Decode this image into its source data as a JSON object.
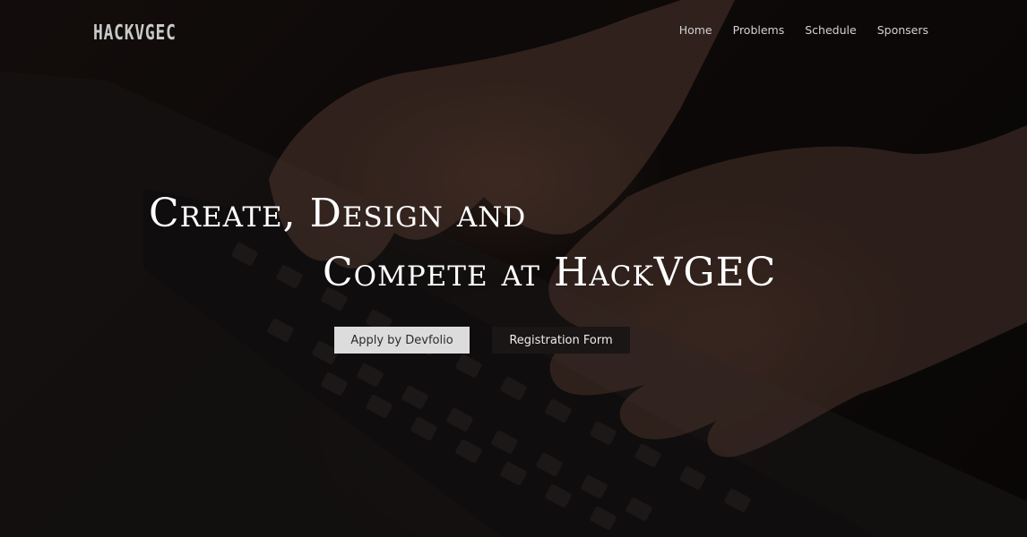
{
  "brand": {
    "logo_text": "HACKVGEC"
  },
  "nav": {
    "items": [
      {
        "label": "Home"
      },
      {
        "label": "Problems"
      },
      {
        "label": "Schedule"
      },
      {
        "label": "Sponsers"
      }
    ]
  },
  "hero": {
    "headline_line1": "Create, Design and",
    "headline_line2": "Compete at HackVGEC",
    "primary_button": "Apply by Devfolio",
    "secondary_button": "Registration Form",
    "background_image": "hands-typing-on-laptop-keyboard"
  },
  "colors": {
    "background": "#120d0c",
    "primary_button_bg": "#dcdcdc",
    "secondary_button_bg": "#1a1615",
    "headline_text": "#ffffff"
  }
}
